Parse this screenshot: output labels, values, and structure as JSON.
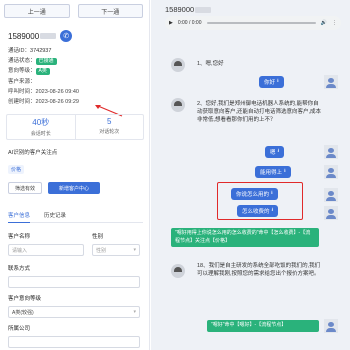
{
  "left": {
    "prev_label": "上一通",
    "next_label": "下一通",
    "phone": "1589000",
    "call_icon": "phone-icon",
    "info": {
      "call_id_label": "通话ID：",
      "call_id": "3742937",
      "status_label": "通话状态：",
      "status": "已接通",
      "intent_label": "意向等级：",
      "intent": "A类",
      "source_label": "客户来源：",
      "source": "",
      "call_time_label": "呼叫时间：",
      "call_time": "2023-08-26 09:40",
      "created_label": "创建时间：",
      "created": "2023-08-26 09:29"
    },
    "stats": [
      {
        "num": "40秒",
        "label": "会话时长"
      },
      {
        "num": "5",
        "label": "对话轮次"
      }
    ],
    "ai_title": "AI识别的客户关注点",
    "ai_tag": "价格",
    "btn_filter": "筛选有效",
    "btn_add": "新增客户中心",
    "tabs": [
      "客户信息",
      "历史记录"
    ],
    "form": {
      "name_label": "客户名称",
      "name_placeholder": "请输入",
      "gender_label": "性别",
      "gender_placeholder": "性别",
      "contact_label": "联系方式",
      "contact_placeholder": "",
      "level_label": "客户意向等级",
      "level_value": "A类(较强)",
      "company_label": "所属公司"
    }
  },
  "right": {
    "phone": "1589000",
    "audio_time": "0:00 / 0:00",
    "messages": [
      {
        "text": "1、嗯,您好"
      },
      {
        "text": "2、您好,我们是郑州御电话机器人系统的,能帮你自动获取意向客户,还能自动打电话筛选意向客户,成本非常低,想看看那你们用的上不？"
      },
      {
        "text": "18、我们是自主研发的系统全部吃饭的我们的,我们可以理解我刚,按照您的需求给您出个报价方案吧。"
      }
    ],
    "bubbles": [
      "你好",
      "嗯",
      "能用得上",
      "你说怎么用的",
      "怎么收费的"
    ],
    "notes": [
      "\"嗯好用得上你说怎么用的怎么收费的\"命中【怎么收费】-【流程节点】关注点【价格】",
      "\"嗯好\"命中【嗯好】-【流程节点】"
    ]
  }
}
